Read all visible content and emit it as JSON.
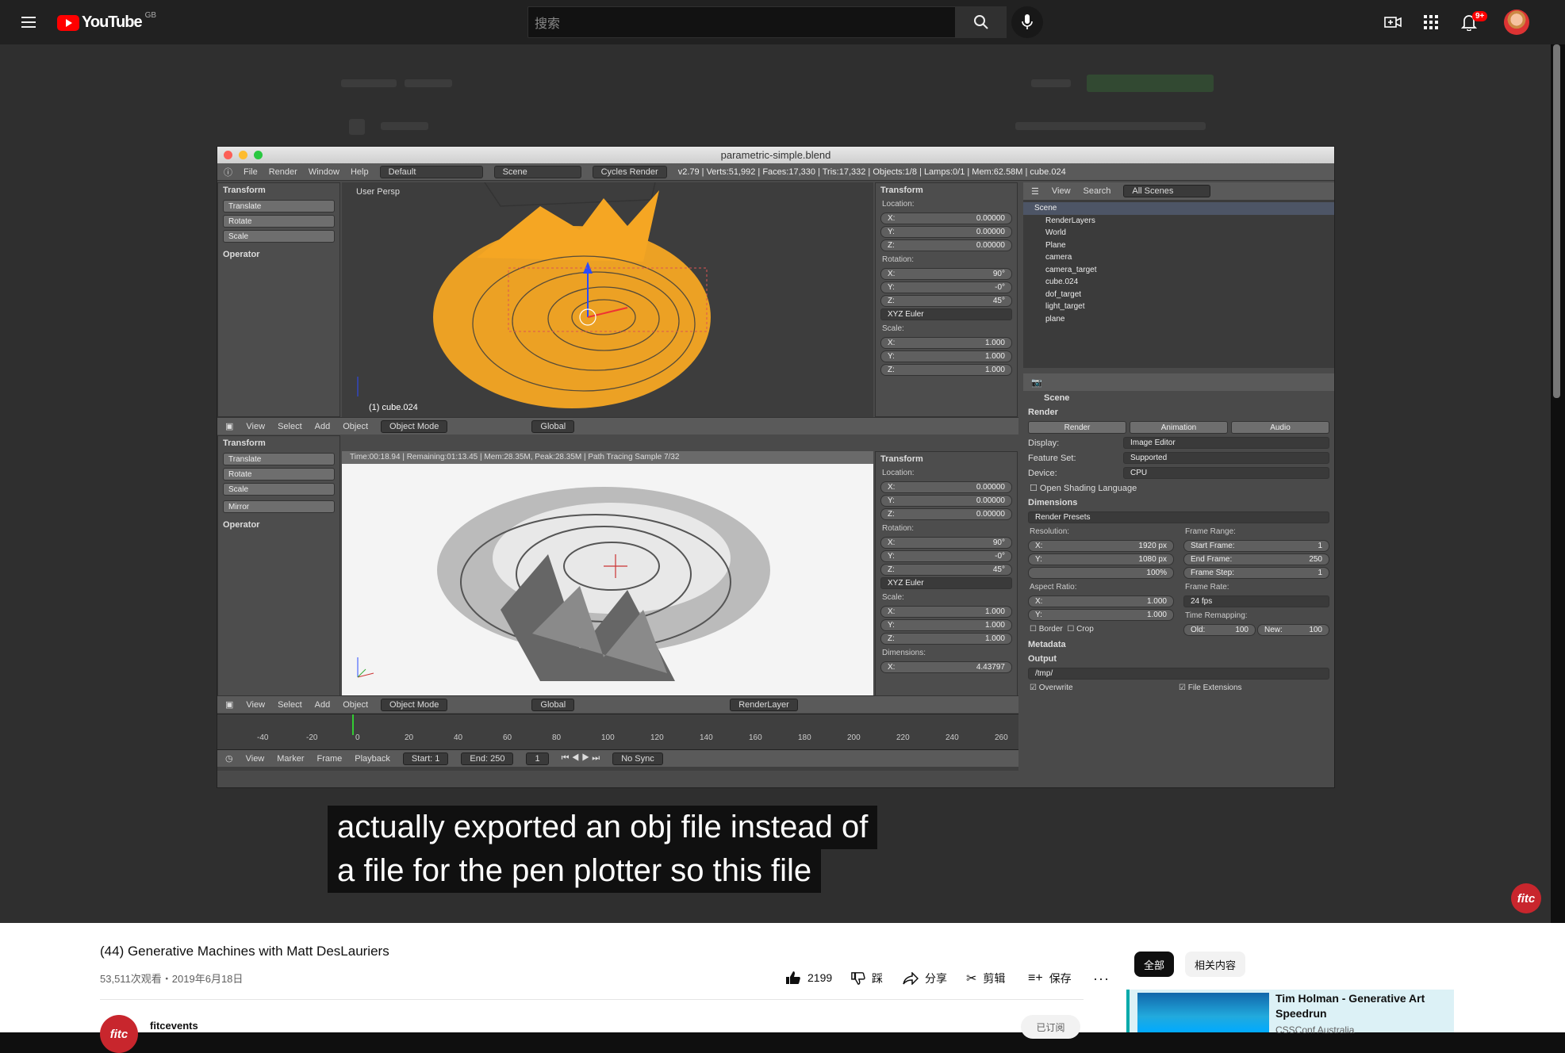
{
  "header": {
    "logo_text": "YouTube",
    "country_code": "GB",
    "search_placeholder": "搜索",
    "notification_count": "9+"
  },
  "blender": {
    "window_title": "parametric-simple.blend",
    "menu": [
      "File",
      "Render",
      "Window",
      "Help"
    ],
    "layout": "Default",
    "scene": "Scene",
    "engine": "Cycles Render",
    "stats": "v2.79 | Verts:51,992 | Faces:17,330 | Tris:17,332 | Objects:1/8 | Lamps:0/1 | Mem:62.58M | cube.024",
    "tool_panel": {
      "transform": "Transform",
      "buttons_top": [
        "Translate",
        "Rotate",
        "Scale"
      ],
      "buttons_bottom": [
        "Translate",
        "Rotate",
        "Scale",
        "Mirror"
      ],
      "operator": "Operator"
    },
    "viewport_label": "User Persp",
    "viewport_object": "(1) cube.024",
    "render_status": "Time:00:18.94 | Remaining:01:13.45 | Mem:28.35M, Peak:28.35M | Path Tracing Sample 7/32",
    "n_panel": {
      "transform": "Transform",
      "location": "Location:",
      "loc": [
        "X:",
        "0.00000",
        "Y:",
        "0.00000",
        "Z:",
        "0.00000"
      ],
      "rotation": "Rotation:",
      "rot": [
        "X:",
        "90°",
        "Y:",
        "-0°",
        "Z:",
        "45°"
      ],
      "euler": "XYZ Euler",
      "scale": "Scale:",
      "scl": [
        "X:",
        "1.000",
        "Y:",
        "1.000",
        "Z:",
        "1.000"
      ],
      "dimensions": "Dimensions:",
      "dim_x": "4.43797"
    },
    "viewport_header": [
      "View",
      "Select",
      "Add",
      "Object"
    ],
    "object_mode": "Object Mode",
    "global": "Global",
    "render_layer": "RenderLayer",
    "timeline_ticks": [
      "-40",
      "-20",
      "0",
      "20",
      "40",
      "60",
      "80",
      "100",
      "120",
      "140",
      "160",
      "180",
      "200",
      "220",
      "240",
      "260"
    ],
    "timeline_header": [
      "View",
      "Marker",
      "Frame",
      "Playback"
    ],
    "start_label": "Start:",
    "start_val": "1",
    "end_label": "End:",
    "end_val": "250",
    "current_frame": "1",
    "sync": "No Sync",
    "outliner": {
      "view": "View",
      "search": "Search",
      "all_scenes": "All Scenes",
      "items": [
        "Scene",
        "RenderLayers",
        "World",
        "Plane",
        "camera",
        "camera_target",
        "cube.024",
        "dof_target",
        "light_target",
        "plane"
      ]
    },
    "props": {
      "scene": "Scene",
      "render": "Render",
      "tabs": [
        "Render",
        "Animation",
        "Audio"
      ],
      "display_label": "Display:",
      "display_val": "Image Editor",
      "feature_label": "Feature Set:",
      "feature_val": "Supported",
      "device_label": "Device:",
      "device_val": "CPU",
      "osl": "Open Shading Language",
      "dimensions": "Dimensions",
      "presets": "Render Presets",
      "resolution": "Resolution:",
      "res_x_label": "X:",
      "res_x": "1920 px",
      "res_y_label": "Y:",
      "res_y": "1080 px",
      "res_pct": "100%",
      "aspect": "Aspect Ratio:",
      "asp_x_label": "X:",
      "asp_x": "1.000",
      "asp_y_label": "Y:",
      "asp_y": "1.000",
      "border": "Border",
      "crop": "Crop",
      "frame_range": "Frame Range:",
      "start_frame_label": "Start Frame:",
      "start_frame": "1",
      "end_frame_label": "End Frame:",
      "end_frame": "250",
      "frame_step_label": "Frame Step:",
      "frame_step": "1",
      "frame_rate": "Frame Rate:",
      "fps": "24 fps",
      "time_remap": "Time Remapping:",
      "old_label": "Old:",
      "old": "100",
      "new_label": "New:",
      "new": "100",
      "metadata": "Metadata",
      "output": "Output",
      "path": "/tmp/",
      "overwrite": "Overwrite",
      "file_ext": "File Extensions"
    }
  },
  "subtitle": {
    "line1": "actually exported an obj file instead of",
    "line2": "a file for the pen plotter so this file"
  },
  "video": {
    "title": "(44) Generative Machines with Matt DesLauriers",
    "meta": "53,511次观看・2019年6月18日",
    "likes": "2199",
    "dislike": "踩",
    "share": "分享",
    "clip": "剪辑",
    "save": "保存",
    "channel": "fitcevents",
    "channel_logo": "fitc",
    "subscribed": "已订阅"
  },
  "sidebar": {
    "chips": [
      "全部",
      "相关内容"
    ],
    "rec_title": "Tim Holman - Generative Art Speedrun",
    "rec_channel": "CSSConf Australia"
  },
  "colors": {
    "accent": "#ff0000",
    "orange_mesh": "#f5a623",
    "chip_active": "#0f0f0f"
  }
}
